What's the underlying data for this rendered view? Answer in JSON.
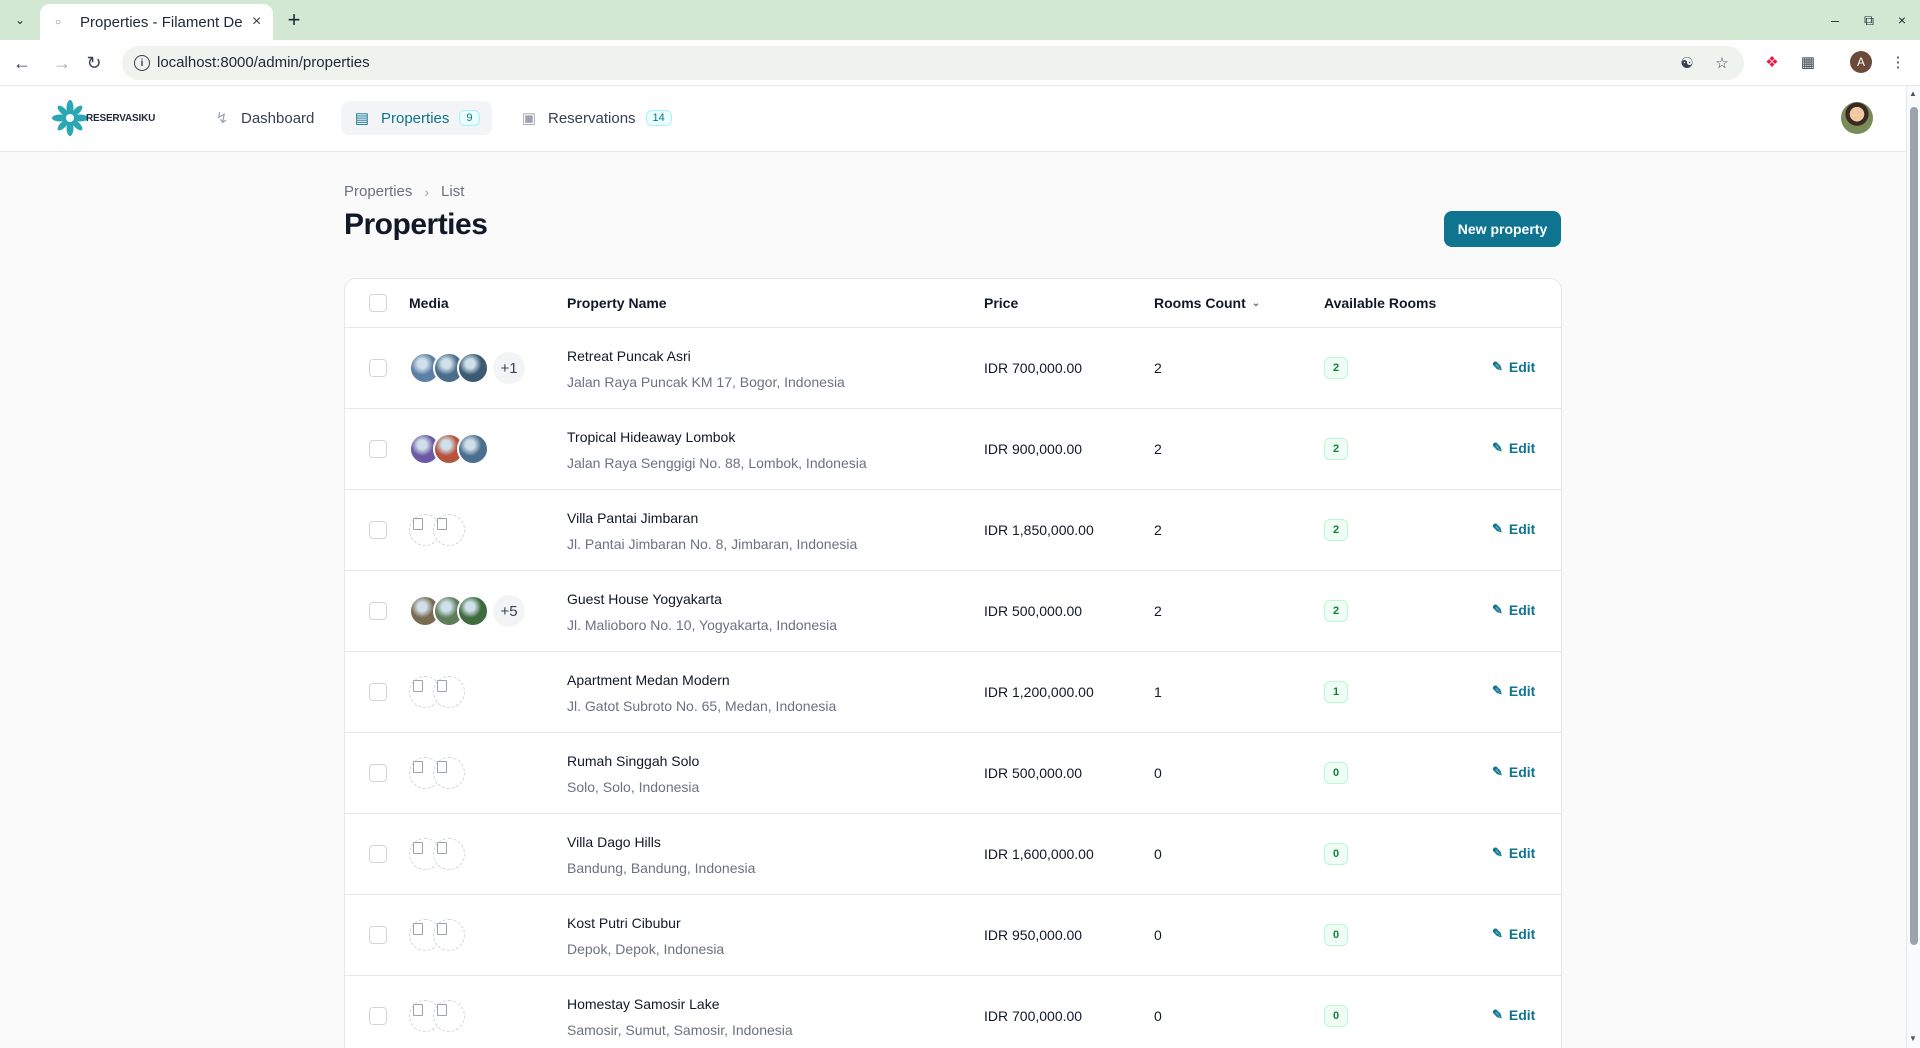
{
  "browser": {
    "tab_title": "Properties - Filament De",
    "url": "localhost:8000/admin/properties",
    "profile_initial": "A"
  },
  "app": {
    "logo_text": "RESERVASIKU",
    "nav": [
      {
        "label": "Dashboard",
        "icon": "bolt-icon",
        "badge": ""
      },
      {
        "label": "Properties",
        "icon": "building-icon",
        "badge": "9"
      },
      {
        "label": "Reservations",
        "icon": "book-icon",
        "badge": "14"
      }
    ]
  },
  "breadcrumb": [
    "Properties",
    "List"
  ],
  "page": {
    "title": "Properties",
    "new_button": "New property"
  },
  "table": {
    "headers": {
      "media": "Media",
      "name": "Property Name",
      "price": "Price",
      "rooms": "Rooms Count",
      "available": "Available Rooms"
    },
    "edit_label": "Edit",
    "rows": [
      {
        "name": "Retreat Puncak Asri",
        "address": "Jalan Raya Puncak KM 17, Bogor, Indonesia",
        "price": "IDR 700,000.00",
        "rooms": "2",
        "available": "2",
        "more": "+1",
        "thumbs": [
          "#5b7fa6",
          "#4a6d8c",
          "#3d5a73"
        ]
      },
      {
        "name": "Tropical Hideaway Lombok",
        "address": "Jalan Raya Senggigi No. 88, Lombok, Indonesia",
        "price": "IDR 900,000.00",
        "rooms": "2",
        "available": "2",
        "more": "",
        "thumbs": [
          "#6b5aa6",
          "#b5533c",
          "#4c6f8f"
        ]
      },
      {
        "name": "Villa Pantai Jimbaran",
        "address": "Jl. Pantai Jimbaran No. 8, Jimbaran, Indonesia",
        "price": "IDR 1,850,000.00",
        "rooms": "2",
        "available": "2",
        "more": "",
        "thumbs": [
          "broken",
          "broken"
        ]
      },
      {
        "name": "Guest House Yogyakarta",
        "address": "Jl. Malioboro No. 10, Yogyakarta, Indonesia",
        "price": "IDR 500,000.00",
        "rooms": "2",
        "available": "2",
        "more": "+5",
        "thumbs": [
          "#7a6a52",
          "#5f7d5a",
          "#3f6b3f"
        ]
      },
      {
        "name": "Apartment Medan Modern",
        "address": "Jl. Gatot Subroto No. 65, Medan, Indonesia",
        "price": "IDR 1,200,000.00",
        "rooms": "1",
        "available": "1",
        "more": "",
        "thumbs": [
          "broken",
          "broken"
        ]
      },
      {
        "name": "Rumah Singgah Solo",
        "address": "Solo, Solo, Indonesia",
        "price": "IDR 500,000.00",
        "rooms": "0",
        "available": "0",
        "more": "",
        "thumbs": [
          "broken",
          "broken"
        ]
      },
      {
        "name": "Villa Dago Hills",
        "address": "Bandung, Bandung, Indonesia",
        "price": "IDR 1,600,000.00",
        "rooms": "0",
        "available": "0",
        "more": "",
        "thumbs": [
          "broken",
          "broken"
        ]
      },
      {
        "name": "Kost Putri Cibubur",
        "address": "Depok, Depok, Indonesia",
        "price": "IDR 950,000.00",
        "rooms": "0",
        "available": "0",
        "more": "",
        "thumbs": [
          "broken",
          "broken"
        ]
      },
      {
        "name": "Homestay Samosir Lake",
        "address": "Samosir, Sumut, Samosir, Indonesia",
        "price": "IDR 700,000.00",
        "rooms": "0",
        "available": "0",
        "more": "",
        "thumbs": [
          "broken",
          "broken"
        ]
      }
    ]
  },
  "colors": {
    "primary": "#0e7490",
    "success": "#15803d"
  }
}
